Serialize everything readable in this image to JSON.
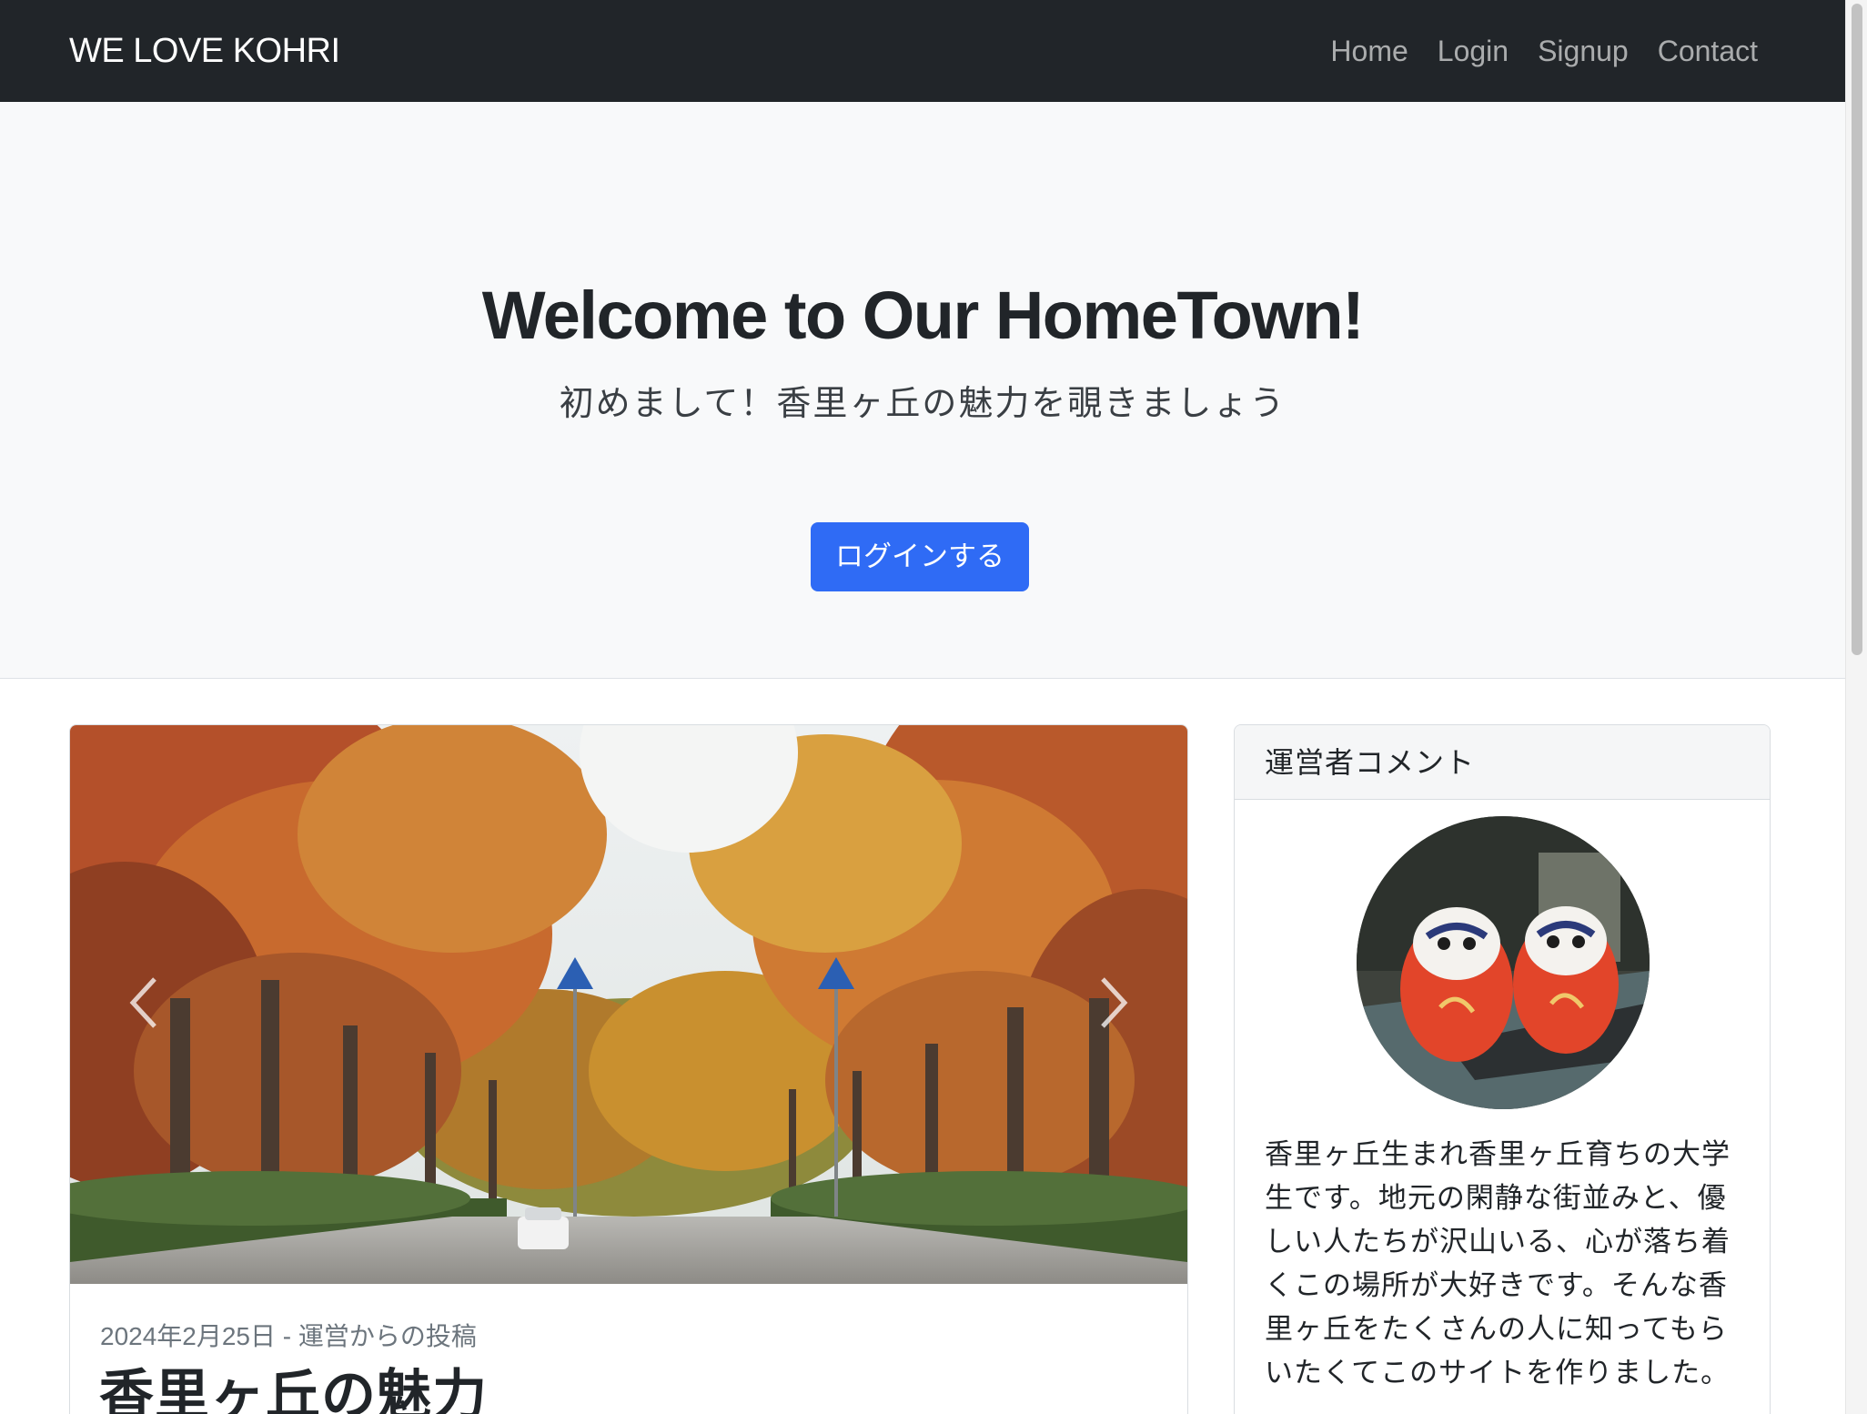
{
  "navbar": {
    "brand": "WE LOVE KOHRI",
    "links": [
      "Home",
      "Login",
      "Signup",
      "Contact"
    ]
  },
  "hero": {
    "title": "Welcome to Our HomeTown!",
    "subtitle": "初めまして！香里ヶ丘の魅力を覗きましょう",
    "button_label": "ログインする"
  },
  "post": {
    "meta": "2024年2月25日 - 運営からの投稿",
    "title": "香里ヶ丘の魅力"
  },
  "carousel": {
    "prev_icon": "chevron-left-icon",
    "next_icon": "chevron-right-icon"
  },
  "sidebar": {
    "header": "運営者コメント",
    "comment": "香里ヶ丘生まれ香里ヶ丘育ちの大学生です。地元の閑静な街並みと、優しい人たちが沢山いる、心が落ち着くこの場所が大好きです。そんな香里ヶ丘をたくさんの人に知ってもらいたくてこのサイトを作りました。"
  },
  "colors": {
    "navbar_bg": "#212529",
    "primary": "#2f6bf5",
    "hero_bg": "#f8f9fa"
  }
}
